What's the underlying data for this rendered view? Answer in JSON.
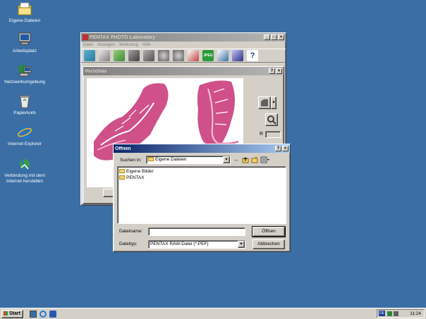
{
  "desktop": {
    "icons": [
      {
        "label": "Eigene Dateien",
        "icon": "folder-documents-icon"
      },
      {
        "label": "Arbeitsplatz",
        "icon": "my-computer-icon"
      },
      {
        "label": "Netzwerkumgebung",
        "icon": "network-icon"
      },
      {
        "label": "Papierkorb",
        "icon": "recycle-bin-icon"
      },
      {
        "label": "Internet Explorer",
        "icon": "internet-explorer-icon"
      },
      {
        "label": "Verbindung mit dem Internet herstellen",
        "icon": "internet-connection-icon"
      }
    ]
  },
  "pentax_window": {
    "title": "PENTAX PHOTO Laboratory",
    "menu": [
      "Datei",
      "Anzeigen",
      "Werkzeug",
      "Hilfe"
    ],
    "jpeg_label": "JPEG",
    "preview_title": "Vorschau",
    "r_label": "R"
  },
  "dialog": {
    "title": "Öffnen",
    "look_in_label": "Suchen in:",
    "look_in_value": "Eigene Dateien",
    "files": [
      {
        "name": "Eigene Bilder"
      },
      {
        "name": "PENTAX"
      }
    ],
    "filename_label": "Dateiname:",
    "filename_value": "",
    "filetype_label": "Dateityp:",
    "filetype_value": "PENTAX RAW-Datei (*.PEF)",
    "open_button": "Öffnen",
    "cancel_button": "Abbrechen"
  },
  "taskbar": {
    "start_label": "Start",
    "clock": "11:24",
    "lang": "DE"
  },
  "colors": {
    "desktop": "#3a6ea5",
    "tissue": "#d0508a",
    "title_active": "#0a246a"
  }
}
